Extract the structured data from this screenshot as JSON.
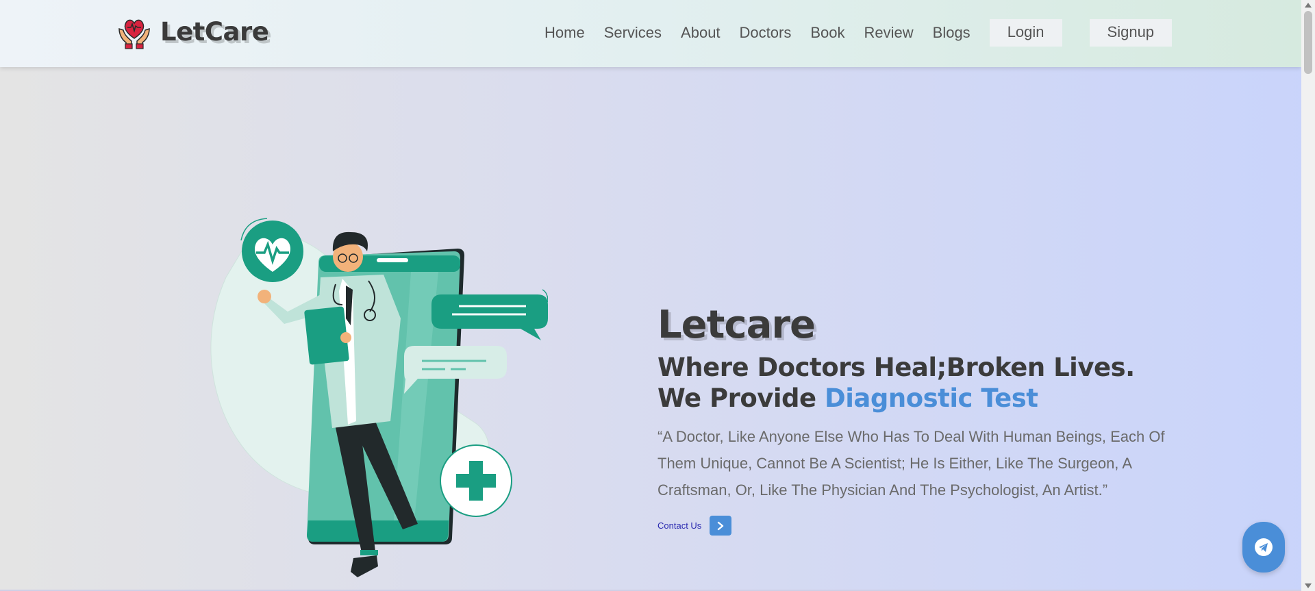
{
  "brand": {
    "name": "LetCare",
    "logo_icon": "heart-hands-icon"
  },
  "nav": {
    "links": [
      "Home",
      "Services",
      "About",
      "Doctors",
      "Book",
      "Review",
      "Blogs"
    ],
    "login_label": "Login",
    "signup_label": "Signup"
  },
  "hero": {
    "title": "Letcare",
    "subtitle_line1": "Where Doctors Heal;Broken Lives.",
    "subtitle_line2_prefix": "We Provide ",
    "subtitle_line2_accent": "Diagnostic Test",
    "quote": "“A Doctor, Like Anyone Else Who Has To Deal With Human Beings, Each Of Them Unique, Cannot Be A Scientist; He Is Either, Like The Surgeon, A Craftsman, Or, Like The Physician And The Psychologist, An Artist.”",
    "contact_label": "Contact Us",
    "contact_icon": "chevron-right-icon"
  },
  "fab": {
    "icon": "telegram-icon"
  },
  "colors": {
    "accent": "#4a8ed8",
    "teal": "#1a9e82",
    "text_dark": "#3b3b3b"
  }
}
